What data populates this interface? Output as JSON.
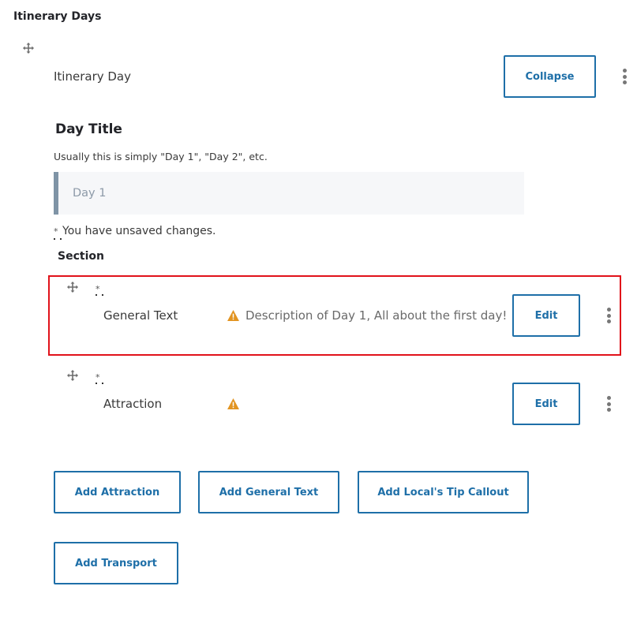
{
  "page": {
    "title": "Itinerary Days"
  },
  "itinerary_day": {
    "label": "Itinerary Day",
    "collapse_label": "Collapse",
    "more_icon": "kebab-vertical-icon",
    "drag_icon": "move-arrows-icon"
  },
  "day_title": {
    "label": "Day Title",
    "description": "Usually this is simply \"Day 1\", \"Day 2\", etc.",
    "value": "Day 1"
  },
  "unsaved": {
    "marker": "*",
    "message": "You have unsaved changes."
  },
  "section": {
    "label": "Section",
    "items": [
      {
        "type": "General Text",
        "changed_marker": "*",
        "warning_icon": "warning-triangle-icon",
        "summary": "Description of Day 1, All about the first day!",
        "edit_label": "Edit",
        "highlighted": true
      },
      {
        "type": "Attraction",
        "changed_marker": "*",
        "warning_icon": "warning-triangle-icon",
        "summary": "",
        "edit_label": "Edit",
        "highlighted": false
      }
    ]
  },
  "add_buttons": [
    {
      "label": "Add Attraction"
    },
    {
      "label": "Add General Text"
    },
    {
      "label": "Add Local's Tip Callout"
    },
    {
      "label": "Add Transport"
    }
  ],
  "colors": {
    "accent": "#1e6fa8",
    "highlight_border": "#e1121a",
    "warning": "#e29421",
    "input_bg": "#f6f7f9",
    "input_left_border": "#7f94a6"
  }
}
